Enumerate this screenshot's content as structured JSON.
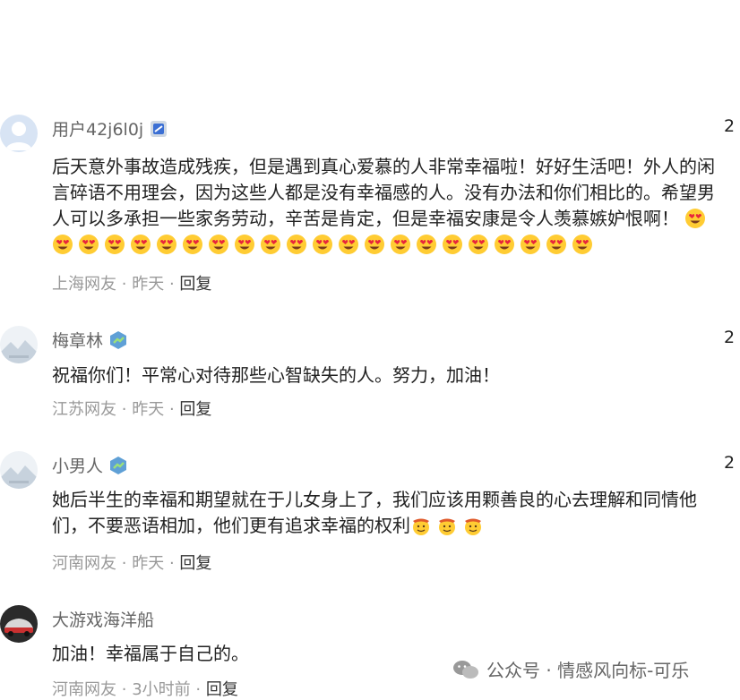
{
  "comments": [
    {
      "username": "用户42j6l0j",
      "likes": "2",
      "text_line1": "后天意外事故造成残疾，但是遇到真心爱慕的人非常幸福啦！好好生活吧！外人的闲",
      "text_line2": "言碎语不用理会，因为这些人都是没有幸福感的人。没有办法和你们相比的。希望男",
      "text_line3": "人可以多承担一些家务劳动，辛苦是肯定，但是幸福安康是令人羡慕嫉妒恨啊！",
      "location": "上海网友",
      "time": "昨天",
      "reply": "回复",
      "emoji": "heart-eyes-emoji",
      "emoji_count": 22
    },
    {
      "username": "梅章林",
      "likes": "2",
      "text_line1": "祝福你们！平常心对待那些心智缺失的人。努力，加油！",
      "location": "江苏网友",
      "time": "昨天",
      "reply": "回复"
    },
    {
      "username": "小男人",
      "likes": "2",
      "text_line1": "她后半生的幸福和期望就在于儿女身上了，我们应该用颗善良的心去理解和同情他",
      "text_line2": "们，不要恶语相加，他们更有追求幸福的权利",
      "location": "河南网友",
      "time": "昨天",
      "reply": "回复",
      "emoji": "cowboy-face-emoji",
      "emoji_count": 3
    },
    {
      "username": "大游戏海洋船",
      "text_line1": "加油！幸福属于自己的。",
      "location": "河南网友",
      "time": "3小时前",
      "reply": "回复"
    }
  ],
  "separator": "·",
  "watermark": {
    "text": "公众号 · 情感风向标-可乐",
    "icon": "wechat-icon"
  },
  "colors": {
    "meta": "#999999",
    "username": "#666666",
    "text": "#222222",
    "badge_blue": "#3b6fd4"
  }
}
